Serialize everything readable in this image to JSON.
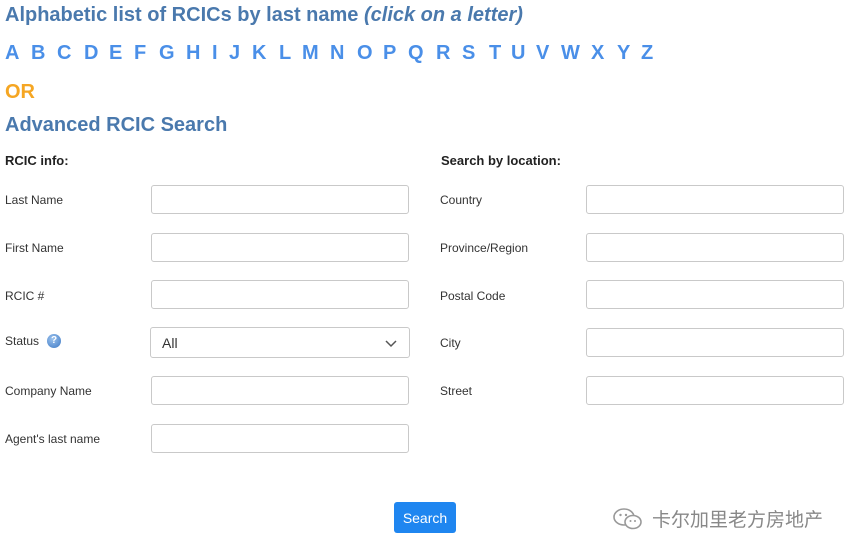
{
  "alphabet": {
    "title": "Alphabetic list of RCICs by last name",
    "hint": "(click on a letter)",
    "letters": [
      "A",
      "B",
      "C",
      "D",
      "E",
      "F",
      "G",
      "H",
      "I",
      "J",
      "K",
      "L",
      "M",
      "N",
      "O",
      "P",
      "Q",
      "R",
      "S",
      "T",
      "U",
      "V",
      "W",
      "X",
      "Y",
      "Z"
    ]
  },
  "or_label": "OR",
  "advanced": {
    "title": "Advanced RCIC Search",
    "rcic_section": "RCIC info:",
    "location_section": "Search by location:",
    "rcic_fields": {
      "last_name": "Last Name",
      "first_name": "First Name",
      "rcic_number": "RCIC #",
      "status": "Status",
      "status_value": "All",
      "company_name": "Company Name",
      "agent_last_name": "Agent's last name"
    },
    "location_fields": {
      "country": "Country",
      "province": "Province/Region",
      "postal_code": "Postal Code",
      "city": "City",
      "street": "Street"
    },
    "search_button": "Search"
  },
  "watermark": "卡尔加里老方房地产",
  "colors": {
    "title": "#4a79ad",
    "letters": "#4a8fe8",
    "or": "#f5a623",
    "button": "#1f86f0"
  }
}
